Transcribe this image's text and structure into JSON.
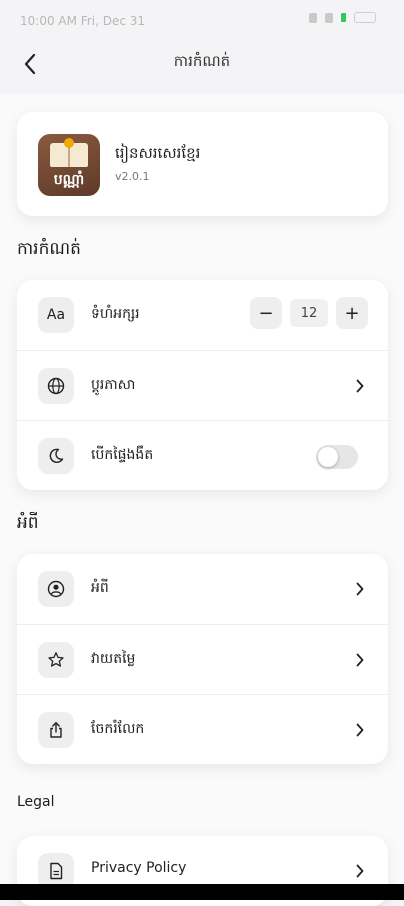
{
  "status_bar": {
    "text": "10:00 AM  Fri, Dec 31"
  },
  "header": {
    "title": "ការកំណត់"
  },
  "app_info": {
    "name": "រៀនសរសេរខ្មែរ",
    "version": "v2.0.1",
    "icon_text": "បណ្ណាំ"
  },
  "settings": {
    "section_title": "ការកំណត់",
    "font_size": {
      "icon": "Aa",
      "label": "ទំហំអក្សរ",
      "value": "12",
      "minus": "−",
      "plus": "+"
    },
    "language": {
      "label": "ប្តូរភាសា"
    },
    "dark_mode": {
      "label": "បើកផ្ទៃងងឹត",
      "enabled": false
    }
  },
  "about": {
    "section_title": "អំពី",
    "items": [
      {
        "label": "អំពី",
        "icon": "user-circle-icon"
      },
      {
        "label": "វាយតម្លៃ",
        "icon": "star-icon"
      },
      {
        "label": "ចែករំលែក",
        "icon": "share-icon"
      }
    ]
  },
  "legal": {
    "section_title": "Legal",
    "items": [
      {
        "label": "Privacy Policy",
        "icon": "document-icon"
      }
    ]
  }
}
